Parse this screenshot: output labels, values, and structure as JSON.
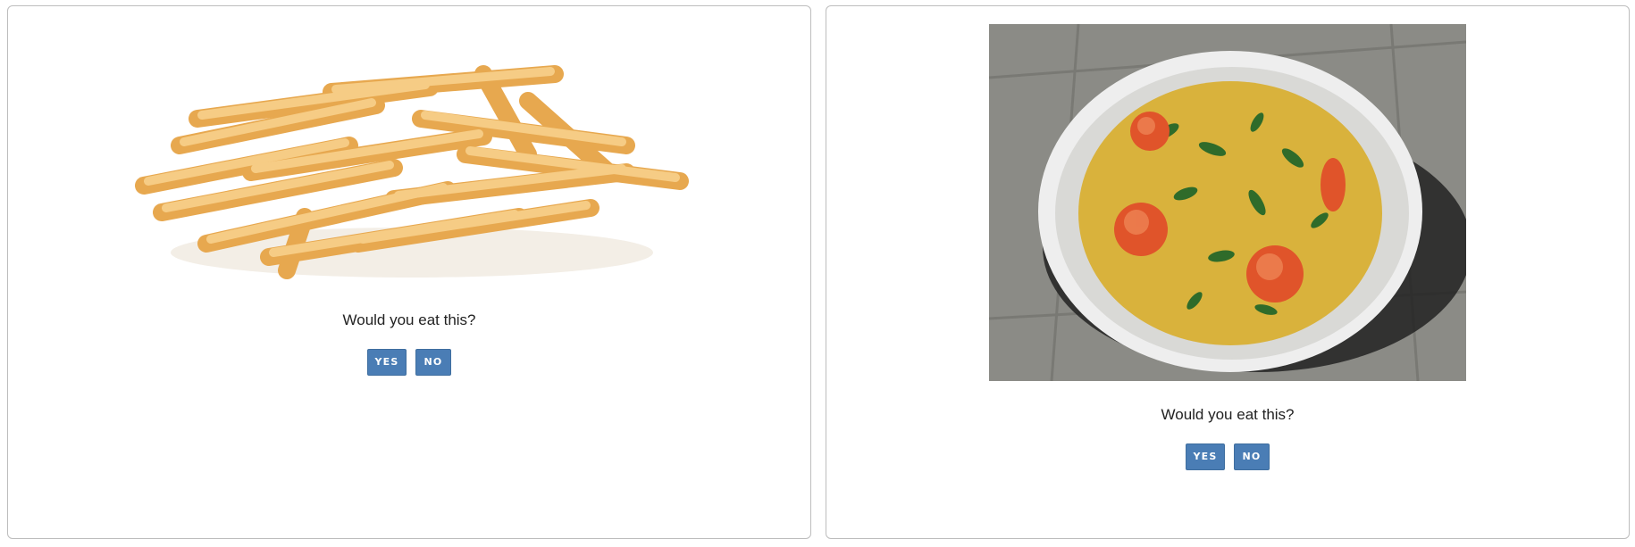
{
  "cards": [
    {
      "image_subject": "french-fries",
      "question": "Would you eat this?",
      "yes_label": "YES",
      "no_label": "NO"
    },
    {
      "image_subject": "shrimp-soup-bowl",
      "question": "Would you eat this?",
      "yes_label": "YES",
      "no_label": "NO"
    }
  ],
  "colors": {
    "button_bg": "#4a7db5",
    "button_text": "#ffffff",
    "card_border": "#bdbdbd",
    "text": "#222222"
  }
}
